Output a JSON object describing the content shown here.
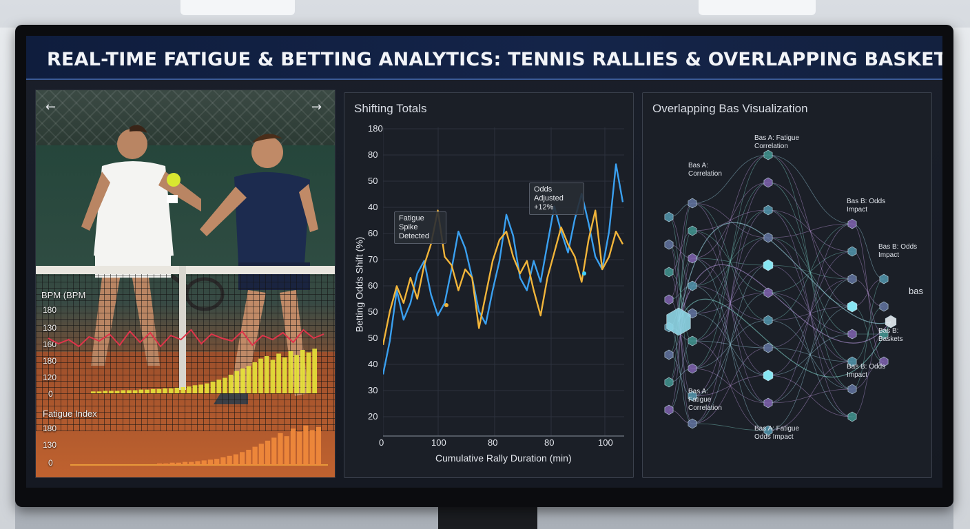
{
  "header": {
    "title": "REAL-TIME FATIGUE & BETTING ANALYTICS: TENNIS RALLIES & OVERLAPPING BASKETS"
  },
  "video": {
    "prev_icon": "arrow-left-icon",
    "next_icon": "arrow-right-icon",
    "bpm_label": "BPM (BPM",
    "bpm_ticks": [
      "180",
      "130",
      "160",
      "180",
      "120",
      "0"
    ],
    "fatigue_label": "Fatigue Index",
    "fatigue_ticks": [
      "180",
      "130",
      "0"
    ],
    "bpm_line": [
      140,
      132,
      138,
      128,
      142,
      136,
      146,
      130,
      150,
      134,
      148,
      128,
      144,
      138,
      152,
      132,
      146,
      140,
      136,
      150,
      130,
      144,
      138,
      148,
      134,
      152,
      140,
      146
    ],
    "bpm_bars": [
      3,
      3,
      4,
      4,
      4,
      5,
      5,
      5,
      6,
      6,
      7,
      7,
      8,
      8,
      9,
      10,
      11,
      13,
      14,
      16,
      19,
      22,
      25,
      30,
      36,
      40,
      44,
      50,
      56,
      60,
      54,
      64,
      58,
      68,
      62,
      70,
      66,
      72
    ],
    "fatigue_bars": [
      2,
      2,
      3,
      3,
      4,
      4,
      5,
      6,
      7,
      8,
      10,
      12,
      14,
      17,
      20,
      24,
      28,
      32,
      36,
      42,
      38,
      48,
      44,
      52,
      46,
      50
    ]
  },
  "shifting_totals": {
    "title": "Shifting Totals",
    "callouts": {
      "spike": "Fatigue Spike Detected",
      "odds": "Odds Adjusted +12%"
    },
    "colors": {
      "blue": "#3aa0f0",
      "orange": "#f2b53a"
    },
    "chart_data": {
      "type": "line",
      "ylabel": "Betting Odds Shift (%)",
      "xlabel": "Cumulative Rally Duration (min)",
      "yticks": [
        "180",
        "80",
        "50",
        "40",
        "60",
        "70",
        "60",
        "50",
        "50",
        "40",
        "30",
        "20"
      ],
      "xticks": [
        "0",
        "100",
        "80",
        "80",
        "100"
      ],
      "series": [
        {
          "values": [
            35,
            43,
            55,
            48,
            52,
            59,
            62,
            54,
            49,
            52,
            60,
            69,
            65,
            58,
            50,
            47,
            55,
            62,
            73,
            68,
            58,
            55,
            62,
            57,
            66,
            75,
            69,
            64,
            72,
            78,
            71,
            63,
            60,
            69,
            85,
            76
          ]
        },
        {
          "values": [
            42,
            50,
            56,
            52,
            58,
            53,
            61,
            66,
            74,
            63,
            61,
            55,
            60,
            58,
            46,
            54,
            62,
            67,
            69,
            63,
            59,
            62,
            55,
            49,
            58,
            64,
            70,
            66,
            63,
            57,
            67,
            74,
            60,
            63,
            69,
            66
          ]
        }
      ]
    }
  },
  "network": {
    "title": "Overlapping Bas Visualization",
    "labels": {
      "top_center": "Bas A: Fatigue Correlation",
      "top_left": "Bas A: Correlation",
      "top_right": "Bas B: Odds Impact",
      "mid_right": "Bas B: Odds Impact",
      "right_end": "bas",
      "low_right": "Bas B: Baskets",
      "lower_right": "Bas B: Odds Impact",
      "bottom_left": "Bas A: Fatigue Correlation",
      "bottom_center": "Bas A: Fatigue Odds Impact"
    }
  }
}
